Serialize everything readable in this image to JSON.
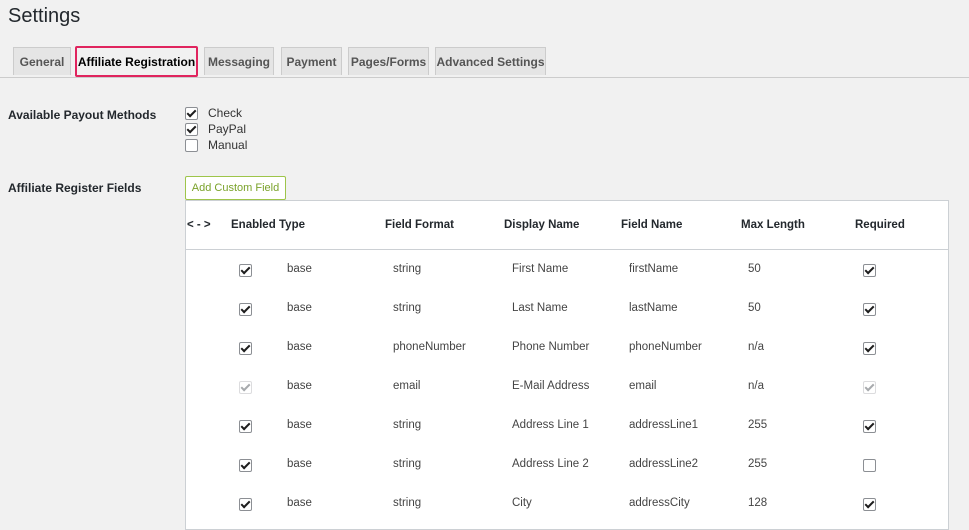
{
  "page_title": "Settings",
  "tabs": [
    {
      "label": "General"
    },
    {
      "label": "Affiliate Registration"
    },
    {
      "label": "Messaging"
    },
    {
      "label": "Payment"
    },
    {
      "label": "Pages/Forms"
    },
    {
      "label": "Advanced Settings"
    }
  ],
  "active_tab": "Affiliate Registration",
  "payout": {
    "label": "Available Payout Methods",
    "options": [
      {
        "label": "Check",
        "checked": true
      },
      {
        "label": "PayPal",
        "checked": true
      },
      {
        "label": "Manual",
        "checked": false
      }
    ]
  },
  "register_fields": {
    "label": "Affiliate Register Fields",
    "add_button": "Add Custom Field",
    "columns": {
      "drag": "< - >",
      "enabled": "Enabled",
      "type": "Type",
      "format": "Field Format",
      "display": "Display Name",
      "name": "Field Name",
      "max": "Max Length",
      "required": "Required"
    },
    "rows": [
      {
        "enabled": true,
        "locked": false,
        "type": "base",
        "format": "string",
        "display": "First Name",
        "name": "firstName",
        "max": "50",
        "required": true
      },
      {
        "enabled": true,
        "locked": false,
        "type": "base",
        "format": "string",
        "display": "Last Name",
        "name": "lastName",
        "max": "50",
        "required": true
      },
      {
        "enabled": true,
        "locked": false,
        "type": "base",
        "format": "phoneNumber",
        "display": "Phone Number",
        "name": "phoneNumber",
        "max": "n/a",
        "required": true
      },
      {
        "enabled": true,
        "locked": true,
        "type": "base",
        "format": "email",
        "display": "E-Mail Address",
        "name": "email",
        "max": "n/a",
        "required": true
      },
      {
        "enabled": true,
        "locked": false,
        "type": "base",
        "format": "string",
        "display": "Address Line 1",
        "name": "addressLine1",
        "max": "255",
        "required": true
      },
      {
        "enabled": true,
        "locked": false,
        "type": "base",
        "format": "string",
        "display": "Address Line 2",
        "name": "addressLine2",
        "max": "255",
        "required": false
      },
      {
        "enabled": true,
        "locked": false,
        "type": "base",
        "format": "string",
        "display": "City",
        "name": "addressCity",
        "max": "128",
        "required": true
      }
    ]
  },
  "colors": {
    "active_tab_border": "#e0245e",
    "add_button": "#7aa22a"
  }
}
